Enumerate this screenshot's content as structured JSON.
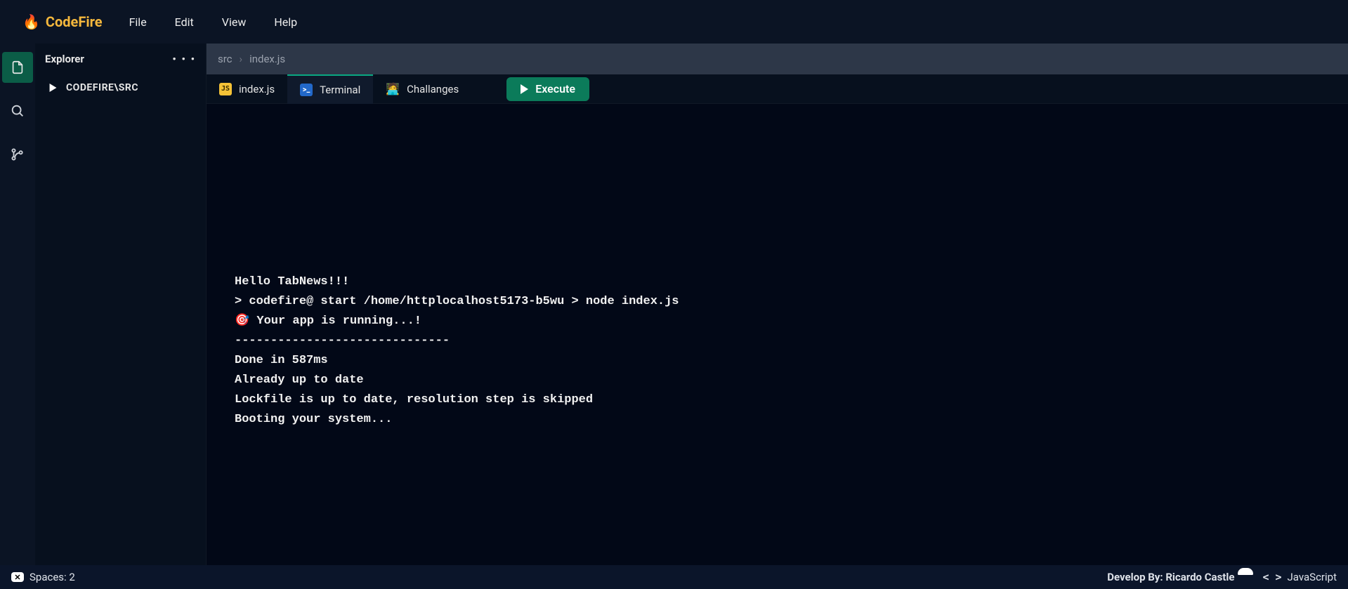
{
  "brand": {
    "emoji": "🔥",
    "name": "CodeFire"
  },
  "menu": [
    "File",
    "Edit",
    "View",
    "Help"
  ],
  "sidebar": {
    "title": "Explorer",
    "more": "• • •",
    "root": "CODEFIRE\\SRC"
  },
  "breadcrumb": {
    "a": "src",
    "sep": "›",
    "b": "index.js"
  },
  "tabs": [
    {
      "icon": "js",
      "label": "index.js"
    },
    {
      "icon": "terminal",
      "label": "Terminal"
    },
    {
      "icon": "challenge",
      "label": "Challanges"
    }
  ],
  "execute": "Execute",
  "terminal": {
    "lines": [
      "Hello TabNews!!!",
      "> codefire@ start /home/httplocalhost5173-b5wu > node index.js",
      "🎯 Your app is running...!",
      "------------------------------",
      "Done in 587ms",
      "Already up to date",
      "Lockfile is up to date, resolution step is skipped",
      "Booting your system..."
    ]
  },
  "status": {
    "spaces": "Spaces: 2",
    "credit": "Develop By: Ricardo Castle",
    "lang": "JavaScript"
  }
}
